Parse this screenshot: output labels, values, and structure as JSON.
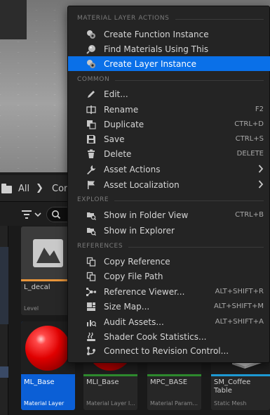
{
  "breadcrumb": {
    "root_label": "All",
    "current_label": "Con"
  },
  "assets": [
    {
      "name": "L_decal",
      "type": "Level",
      "stripe": "#e8953a"
    },
    {
      "name": "ML_Base",
      "type": "Material Layer",
      "stripe": "#0b5fd6",
      "selected": true
    },
    {
      "name": "MLI_Base",
      "type": "Material Layer I...",
      "stripe": "#2e8b2e"
    },
    {
      "name": "MPC_BASE",
      "type": "Material Param...",
      "stripe": "#2e8b2e"
    },
    {
      "name": "SM_Coffee Table",
      "type": "Static Mesh",
      "stripe": "#1e9bd6"
    }
  ],
  "menu": {
    "sections": [
      {
        "header": "MATERIAL LAYER ACTIONS",
        "items": [
          {
            "label": "Create Function Instance",
            "icon": "material-instance-icon"
          },
          {
            "label": "Find Materials Using This",
            "icon": "sphere-search-icon"
          },
          {
            "label": "Create Layer Instance",
            "icon": "material-instance-icon",
            "highlighted": true
          }
        ]
      },
      {
        "header": "COMMON",
        "items": [
          {
            "label": "Edit...",
            "icon": "pencil-icon"
          },
          {
            "label": "Rename",
            "icon": "rename-icon",
            "shortcut": "F2"
          },
          {
            "label": "Duplicate",
            "icon": "duplicate-icon",
            "shortcut": "CTRL+D"
          },
          {
            "label": "Save",
            "icon": "save-icon",
            "shortcut": "CTRL+S"
          },
          {
            "label": "Delete",
            "icon": "trash-icon",
            "shortcut": "DELETE"
          },
          {
            "label": "Asset Actions",
            "icon": "wrench-icon",
            "submenu": true
          },
          {
            "label": "Asset Localization",
            "icon": "flag-icon",
            "submenu": true
          }
        ]
      },
      {
        "header": "EXPLORE",
        "items": [
          {
            "label": "Show in Folder View",
            "icon": "folder-search-icon",
            "shortcut": "CTRL+B"
          },
          {
            "label": "Show in Explorer",
            "icon": "folder-search-icon"
          }
        ]
      },
      {
        "header": "REFERENCES",
        "items": [
          {
            "label": "Copy Reference",
            "icon": "copy-icon"
          },
          {
            "label": "Copy File Path",
            "icon": "copy-icon"
          },
          {
            "label": "Reference Viewer...",
            "icon": "reference-graph-icon",
            "shortcut": "ALT+SHIFT+R"
          },
          {
            "label": "Size Map...",
            "icon": "size-map-icon",
            "shortcut": "ALT+SHIFT+M"
          },
          {
            "label": "Audit Assets...",
            "icon": "audit-icon",
            "shortcut": "ALT+SHIFT+A"
          },
          {
            "label": "Shader Cook Statistics...",
            "icon": "shader-icon"
          },
          {
            "label": "Connect to Revision Control...",
            "icon": "revision-control-icon"
          }
        ]
      }
    ]
  },
  "colors": {
    "menu_bg": "#242424",
    "highlight": "#0a70e8",
    "selected_tile": "#0b5fd6"
  }
}
